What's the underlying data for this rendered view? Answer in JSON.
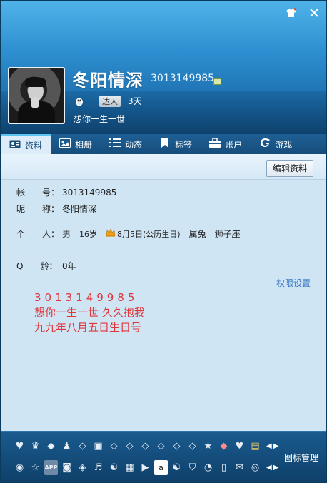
{
  "window": {
    "shirt_icon": "shirt-icon",
    "close_icon": "close-icon"
  },
  "profile": {
    "nickname": "冬阳情深",
    "qq_number": "3013149985",
    "talent_label": "达人",
    "days": "3天",
    "signature": "想你一生一世"
  },
  "tabs": [
    {
      "label": "资料",
      "icon": "card-icon"
    },
    {
      "label": "相册",
      "icon": "photo-icon"
    },
    {
      "label": "动态",
      "icon": "list-icon"
    },
    {
      "label": "标签",
      "icon": "bookmark-icon"
    },
    {
      "label": "账户",
      "icon": "briefcase-icon"
    },
    {
      "label": "游戏",
      "icon": "game-icon"
    }
  ],
  "toolbar": {
    "edit_label": "编辑资料"
  },
  "info": {
    "account_label": "帐　　号：",
    "account_value": "3013149985",
    "nickname_label": "昵　　称：",
    "nickname_value": "冬阳情深",
    "personal_label": "个　　人：",
    "gender": "男",
    "age": "16岁",
    "birthday": "8月5日(公历生日)",
    "zodiac": "属兔",
    "constellation": "狮子座",
    "qage_label": "Q　　龄：",
    "qage_value": "0年"
  },
  "permissions_link": "权限设置",
  "note": {
    "line1": "3013149985",
    "line2": "想你一生一世 久久抱我",
    "line3": "九九年八月五日生日号"
  },
  "bottom": {
    "manage_label": "图标管理",
    "row1_icons": [
      "heart-badge-icon",
      "penguin-crown-icon",
      "diamond-dark-icon",
      "penguin-icon",
      "diamond-icon",
      "robot-icon",
      "diamond-icon",
      "diamond-icon",
      "diamond-icon",
      "diamond-icon",
      "diamond-icon",
      "diamond-icon",
      "star-icon",
      "diamond-red-icon",
      "heart-icon",
      "gift-icon"
    ],
    "row2_icons": [
      "eye-icon",
      "star-icon",
      "app-icon",
      "camera-icon",
      "shield-icon",
      "music-icon",
      "qq-icon",
      "film-icon",
      "video-icon",
      "text-icon",
      "yin-yang-icon",
      "shield-v-icon",
      "pie-icon",
      "phone-icon",
      "mail-icon",
      "circle-icon"
    ],
    "app_label": "APP"
  },
  "colors": {
    "header_top": "#4fb3e8",
    "header_bottom": "#1a5f96",
    "content_bg": "#cfe5f4",
    "note_red": "#e0353a",
    "link_blue": "#3577c0"
  }
}
